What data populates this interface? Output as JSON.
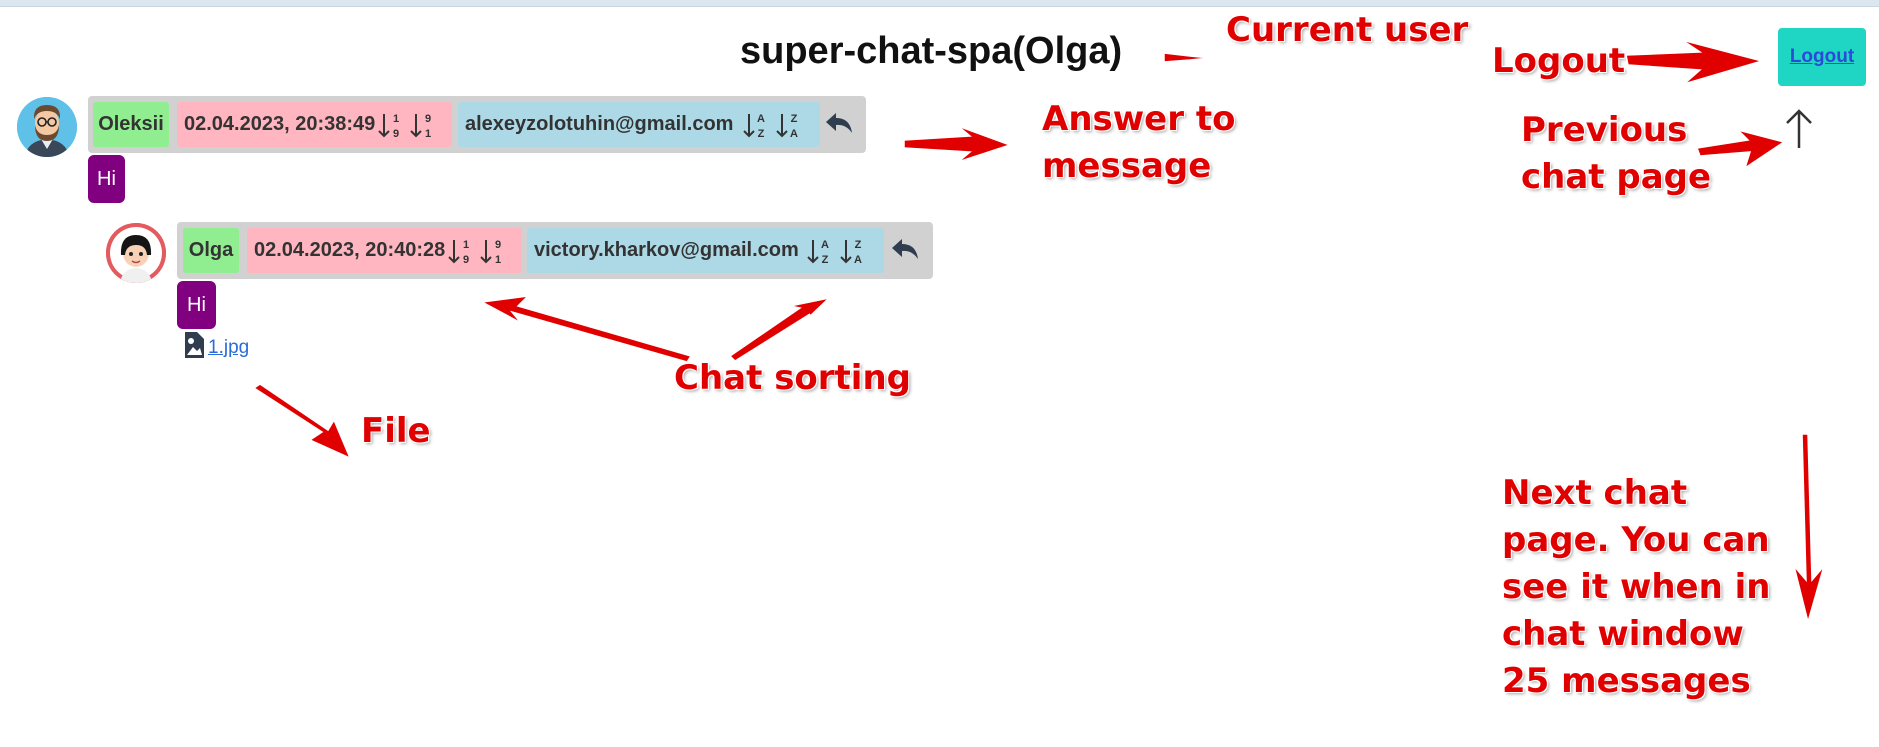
{
  "header": {
    "title": "super-chat-spa(Olga)",
    "logout_label": "Logout"
  },
  "messages": [
    {
      "name": "Oleksii",
      "date": "02.04.2023, 20:38:49",
      "email": "alexeyzolotuhin@gmail.com",
      "text": "Hi",
      "avatar": "bearded-man-avatar-icon"
    },
    {
      "name": "Olga",
      "date": "02.04.2023, 20:40:28",
      "email": "victory.kharkov@gmail.com",
      "text": "Hi",
      "file": "1.jpg",
      "avatar": "girl-avatar-icon"
    }
  ],
  "sort_labels": {
    "asc_top": "1",
    "asc_bottom": "9",
    "desc_top": "9",
    "desc_bottom": "1",
    "alpha_asc_top": "A",
    "alpha_asc_bottom": "Z",
    "alpha_desc_top": "Z",
    "alpha_desc_bottom": "A"
  },
  "annotations": {
    "current_user": "Current user",
    "logout": "Logout",
    "answer_line1": "Answer to",
    "answer_line2": "message",
    "previous_line1": "Previous",
    "previous_line2": "chat page",
    "chat_sorting": "Chat sorting",
    "file": "File",
    "next_lines": [
      "Next chat",
      "page. You can",
      "see it when in",
      "chat window",
      "25 messages"
    ]
  },
  "colors": {
    "name_bg": "#90ee90",
    "date_bg": "#ffb6c1",
    "email_bg": "#add8e6",
    "bubble_bg": "#800080",
    "logout_bg": "#1fd6c4",
    "annotation": "#e00000"
  }
}
